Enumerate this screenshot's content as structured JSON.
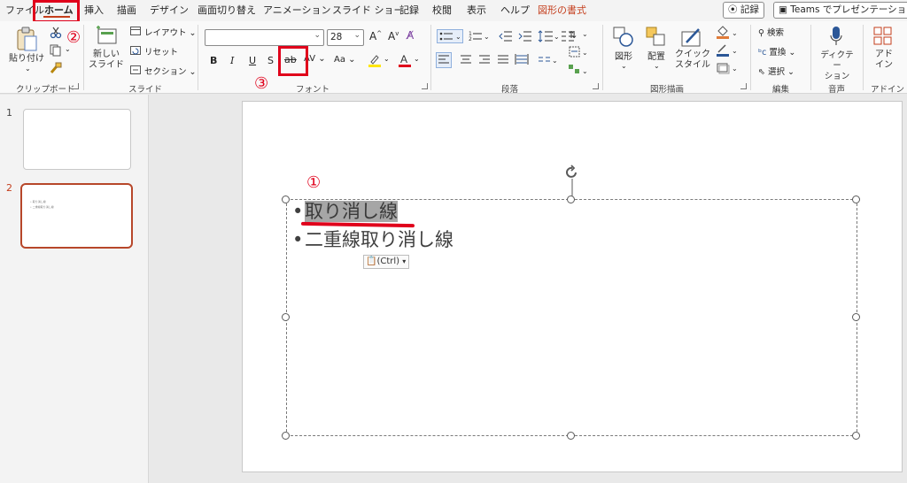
{
  "menu_tabs": [
    {
      "label": "ファイル"
    },
    {
      "label": "ホーム"
    },
    {
      "label": "挿入"
    },
    {
      "label": "描画"
    },
    {
      "label": "デザイン"
    },
    {
      "label": "画面切り替え"
    },
    {
      "label": "アニメーション"
    },
    {
      "label": "スライド ショー"
    },
    {
      "label": "記録"
    },
    {
      "label": "校閲"
    },
    {
      "label": "表示"
    },
    {
      "label": "ヘルプ"
    },
    {
      "label": "図形の書式"
    }
  ],
  "top_right": {
    "record_label": "記録",
    "teams_label": "Teams でプレゼンテーション"
  },
  "ribbon": {
    "clipboard": {
      "paste_label": "貼り付け",
      "group_label": "クリップボード"
    },
    "slides": {
      "new_slide_label": "新しい\nスライド",
      "layout_label": "レイアウト",
      "reset_label": "リセット",
      "section_label": "セクション",
      "group_label": "スライド"
    },
    "font": {
      "font_name": "",
      "font_size": "28",
      "bold": "B",
      "italic": "I",
      "underline": "U",
      "shadow": "S",
      "strike": "ab",
      "spacing": "AV",
      "case": "Aa",
      "group_label": "フォント"
    },
    "paragraph": {
      "group_label": "段落"
    },
    "drawing": {
      "shape_label": "図形",
      "arrange_label": "配置",
      "quick_style_label": "クイック\nスタイル",
      "group_label": "図形描画"
    },
    "editing": {
      "find_label": "検索",
      "replace_label": "置換",
      "select_label": "選択",
      "group_label": "編集"
    },
    "voice": {
      "dictate_label": "ディクテー\nション",
      "group_label": "音声"
    },
    "addins": {
      "addin_label": "アド\nイン",
      "group_label": "アドイン"
    }
  },
  "annotations": {
    "step1": "①",
    "step2": "②",
    "step3": "③"
  },
  "slides_panel": {
    "slides": [
      {
        "number": "1",
        "lines": []
      },
      {
        "number": "2",
        "lines": [
          "• 取り消し線",
          "• 二重線取り消し線"
        ]
      }
    ]
  },
  "slide": {
    "bullets": [
      {
        "text": "取り消し線",
        "selected": true
      },
      {
        "text": "二重線取り消し線",
        "selected": false
      }
    ],
    "paste_chip": "(Ctrl)"
  },
  "colors": {
    "accent": "#c43e1c",
    "annotation_red": "#e0001b",
    "selection": "#a6a6a6"
  }
}
